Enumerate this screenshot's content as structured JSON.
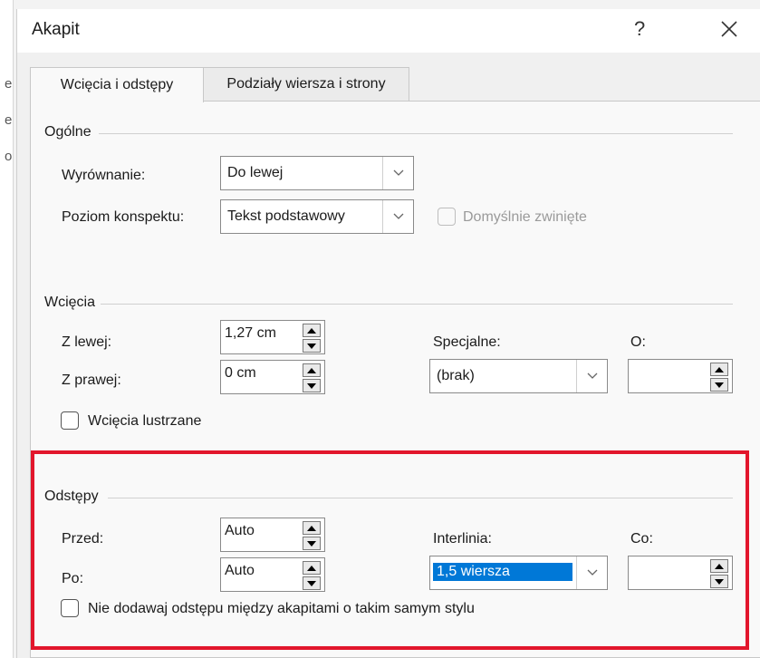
{
  "background": {
    "left_chars": [
      "e",
      "e",
      "o"
    ]
  },
  "dialog": {
    "title": "Akapit",
    "help_label": "?",
    "tabs": [
      {
        "label": "Wcięcia i odstępy",
        "active": true
      },
      {
        "label": "Podziały wiersza i strony",
        "active": false
      }
    ],
    "general": {
      "title": "Ogólne",
      "alignment_label": "Wyrównanie:",
      "alignment_value": "Do lewej",
      "outline_label": "Poziom konspektu:",
      "outline_value": "Tekst podstawowy",
      "collapsed_label": "Domyślnie zwinięte"
    },
    "indent": {
      "title": "Wcięcia",
      "left_label": "Z lewej:",
      "left_value": "1,27 cm",
      "right_label": "Z prawej:",
      "right_value": "0 cm",
      "special_label": "Specjalne:",
      "special_value": "(brak)",
      "by_label": "O:",
      "by_value": "",
      "mirror_label": "Wcięcia lustrzane"
    },
    "spacing": {
      "title": "Odstępy",
      "before_label": "Przed:",
      "before_value": "Auto",
      "after_label": "Po:",
      "after_value": "Auto",
      "line_label": "Interlinia:",
      "line_value": "1,5 wiersza",
      "at_label": "Co:",
      "at_value": "",
      "no_space_label": "Nie dodawaj odstępu między akapitami o takim samym stylu"
    }
  },
  "colors": {
    "highlight": "#e2162c",
    "selection": "#0078d7"
  }
}
